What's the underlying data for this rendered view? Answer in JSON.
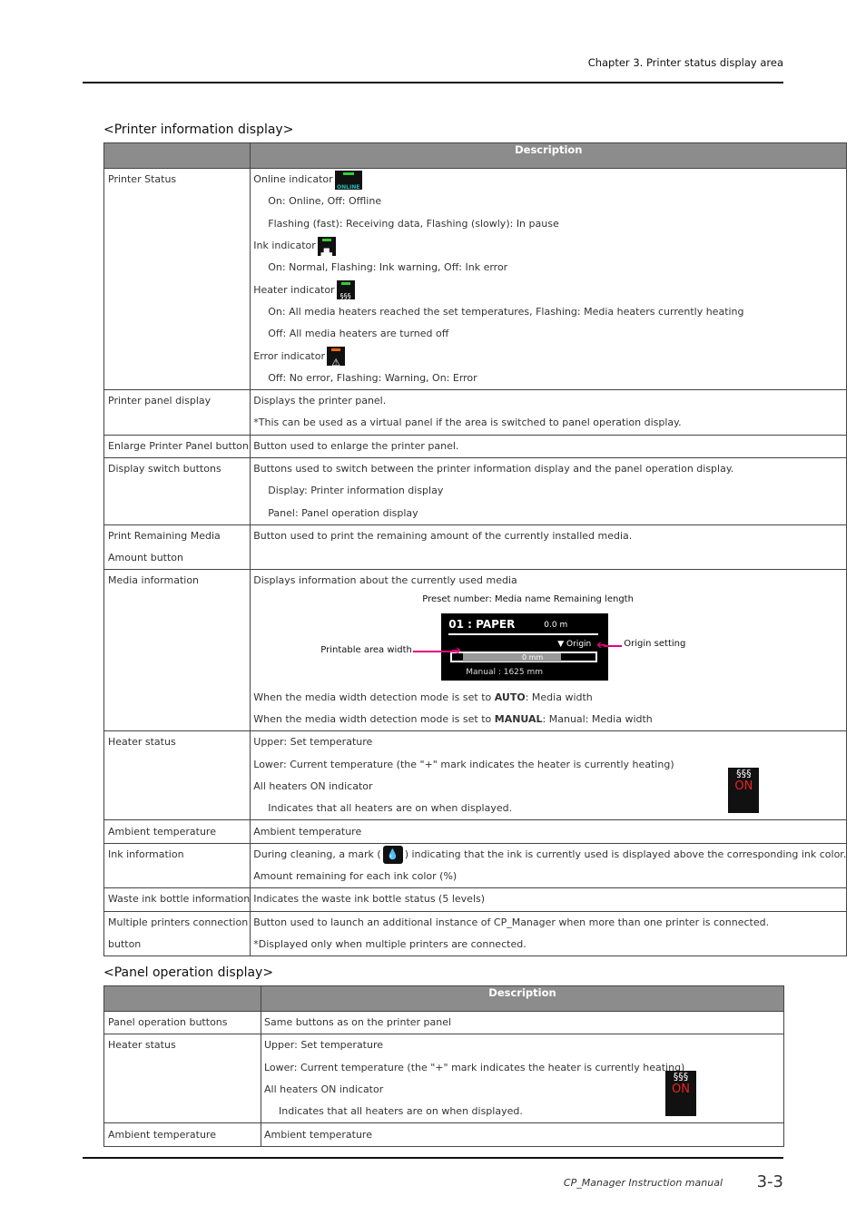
{
  "header": {
    "chapter": "Chapter 3. Printer status display area"
  },
  "section1": {
    "title": "<Printer information display>",
    "col_label": "",
    "col_desc": "Description",
    "rows": [
      {
        "label": [
          "Printer Status"
        ],
        "lines": [
          {
            "parts": [
              {
                "text": "Online indicator"
              },
              {
                "icon": "online",
                "label": "ONLINE"
              }
            ]
          },
          {
            "indent": true,
            "parts": [
              {
                "text": "On: Online, Off: Offline"
              }
            ]
          },
          {
            "indent": true,
            "parts": [
              {
                "text": "Flashing (fast): Receiving data, Flashing (slowly): In pause"
              }
            ]
          },
          {
            "parts": [
              {
                "text": "Ink indicator"
              },
              {
                "icon": "ink"
              }
            ]
          },
          {
            "indent": true,
            "parts": [
              {
                "text": "On: Normal, Flashing: Ink warning, Off: Ink error"
              }
            ]
          },
          {
            "parts": [
              {
                "text": "Heater indicator"
              },
              {
                "icon": "heater"
              }
            ]
          },
          {
            "indent": true,
            "parts": [
              {
                "text": "On: All media heaters reached the set temperatures, Flashing: Media heaters currently heating"
              }
            ]
          },
          {
            "indent": true,
            "parts": [
              {
                "text": "Off: All media heaters are turned off"
              }
            ]
          },
          {
            "parts": [
              {
                "text": "Error indicator"
              },
              {
                "icon": "error"
              }
            ]
          },
          {
            "indent": true,
            "parts": [
              {
                "text": "Off: No error, Flashing: Warning, On: Error"
              }
            ]
          }
        ]
      },
      {
        "label": [
          "Printer panel display"
        ],
        "lines": [
          {
            "parts": [
              {
                "text": "Displays the printer panel."
              }
            ]
          },
          {
            "parts": [
              {
                "text": "*This can be used as a virtual panel if the area is switched to panel operation display."
              }
            ]
          }
        ]
      },
      {
        "label": [
          "Enlarge Printer Panel button"
        ],
        "lines": [
          {
            "parts": [
              {
                "text": "Button used to enlarge the printer panel."
              }
            ]
          }
        ]
      },
      {
        "label": [
          "Display switch buttons"
        ],
        "lines": [
          {
            "parts": [
              {
                "text": "Buttons used to switch between the printer information display and the panel operation display."
              }
            ]
          },
          {
            "indent": true,
            "parts": [
              {
                "text": "Display: Printer information display"
              }
            ]
          },
          {
            "indent": true,
            "parts": [
              {
                "text": "Panel: Panel operation display"
              }
            ]
          }
        ]
      },
      {
        "label": [
          "Print Remaining Media",
          "Amount button"
        ],
        "lines": [
          {
            "parts": [
              {
                "text": "Button used to print the remaining amount of the currently installed media."
              }
            ]
          },
          {
            "parts": []
          }
        ]
      },
      {
        "label": [
          "Media information"
        ],
        "lines": [
          {
            "parts": [
              {
                "text": "Displays information about the currently used media"
              }
            ]
          },
          {
            "diagram": true
          },
          {
            "parts": [
              {
                "text": "When the media width detection mode is set to "
              },
              {
                "text": "AUTO",
                "bold": true
              },
              {
                "text": ": Media width"
              }
            ]
          },
          {
            "parts": [
              {
                "text": "When the media width detection mode is set to "
              },
              {
                "text": "MANUAL",
                "bold": true
              },
              {
                "text": ": Manual: Media width"
              }
            ]
          }
        ]
      },
      {
        "label": [
          "Heater status"
        ],
        "heater_on": true,
        "lines": [
          {
            "parts": [
              {
                "text": "Upper: Set temperature"
              }
            ]
          },
          {
            "parts": [
              {
                "text": "Lower: Current temperature (the \"+\" mark indicates the heater is currently heating)"
              }
            ]
          },
          {
            "parts": [
              {
                "text": "All heaters ON indicator"
              }
            ]
          },
          {
            "indent": true,
            "parts": [
              {
                "text": "Indicates that all heaters are on when displayed."
              }
            ]
          }
        ]
      },
      {
        "label": [
          "Ambient temperature"
        ],
        "lines": [
          {
            "parts": [
              {
                "text": "Ambient temperature"
              }
            ]
          }
        ]
      },
      {
        "label": [
          "Ink information"
        ],
        "lines": [
          {
            "parts": [
              {
                "text": "During cleaning, a mark ("
              },
              {
                "icon": "drop"
              },
              {
                "text": ") indicating that the ink is currently used is displayed above the corresponding ink color."
              }
            ]
          },
          {
            "parts": [
              {
                "text": "Amount remaining for each ink color (%)"
              }
            ]
          }
        ]
      },
      {
        "label": [
          "Waste ink bottle information"
        ],
        "lines": [
          {
            "parts": [
              {
                "text": "Indicates the waste ink bottle status (5 levels)"
              }
            ]
          }
        ]
      },
      {
        "label": [
          "Multiple printers connection",
          "button"
        ],
        "lines": [
          {
            "parts": [
              {
                "text": "Button used to launch an additional instance of CP_Manager when more than one printer is connected."
              }
            ]
          },
          {
            "parts": [
              {
                "text": "*Displayed only when multiple printers are connected."
              }
            ]
          }
        ]
      }
    ]
  },
  "diagram": {
    "top_label": "Preset number: Media name  Remaining length",
    "preset": "01  : PAPER",
    "remaining": "0.0  m",
    "origin": "▼ Origin",
    "width_value": "0  mm",
    "manual": "Manual :  1625   mm",
    "printable_label": "Printable area width",
    "origin_label": "Origin setting"
  },
  "heater_icon": {
    "symbol": "§§§",
    "on": "ON"
  },
  "section2": {
    "title": "<Panel operation display>",
    "col_label": "",
    "col_desc": "Description",
    "rows": [
      {
        "label": [
          "Panel operation buttons"
        ],
        "lines": [
          {
            "parts": [
              {
                "text": "Same buttons as on the printer panel"
              }
            ]
          }
        ]
      },
      {
        "label": [
          "Heater status"
        ],
        "heater_on": true,
        "lines": [
          {
            "parts": [
              {
                "text": "Upper: Set temperature"
              }
            ]
          },
          {
            "parts": [
              {
                "text": "Lower: Current temperature (the \"+\" mark indicates the heater is currently heating)"
              }
            ]
          },
          {
            "parts": [
              {
                "text": "All heaters ON indicator"
              }
            ]
          },
          {
            "indent": true,
            "parts": [
              {
                "text": "Indicates that all heaters are on when displayed."
              }
            ]
          }
        ]
      },
      {
        "label": [
          "Ambient temperature"
        ],
        "lines": [
          {
            "parts": [
              {
                "text": "Ambient temperature"
              }
            ]
          }
        ]
      }
    ]
  },
  "footer": {
    "manual": "CP_Manager Instruction manual",
    "page": "3-3"
  },
  "colors": {
    "header_bg": "#8c8c8c",
    "arrow": "#e6007e",
    "indicator_green": "#33cc33",
    "indicator_orange": "#ff6600",
    "heater_on": "#e22222"
  }
}
